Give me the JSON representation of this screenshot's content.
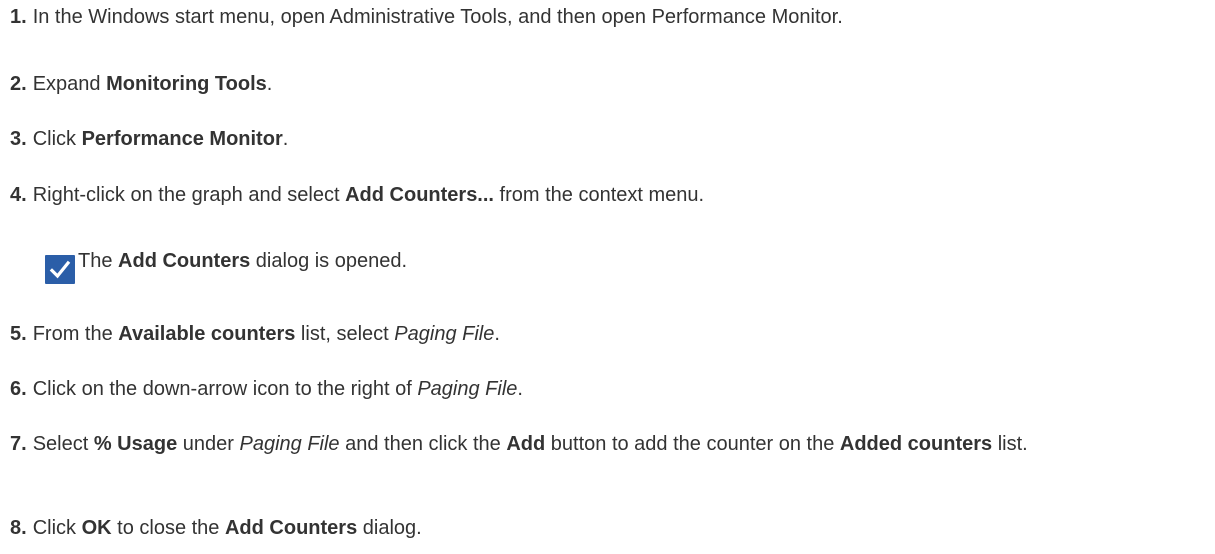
{
  "steps": [
    {
      "number": "1.",
      "parts": [
        {
          "t": "In the Windows start menu, open Administrative Tools, and then open Performance Monitor."
        }
      ]
    },
    {
      "number": "2.",
      "parts": [
        {
          "t": "Expand "
        },
        {
          "t": "Monitoring Tools",
          "s": "b"
        },
        {
          "t": "."
        }
      ]
    },
    {
      "number": "3.",
      "parts": [
        {
          "t": "Click "
        },
        {
          "t": "Performance Monitor",
          "s": "b"
        },
        {
          "t": "."
        }
      ]
    },
    {
      "number": "4.",
      "parts": [
        {
          "t": "Right-click on the graph and select "
        },
        {
          "t": "Add Counters...",
          "s": "b"
        },
        {
          "t": " from the context menu."
        }
      ]
    },
    {
      "number": "5.",
      "parts": [
        {
          "t": "From the "
        },
        {
          "t": "Available counters",
          "s": "b"
        },
        {
          "t": " list, select "
        },
        {
          "t": "Paging File",
          "s": "i"
        },
        {
          "t": "."
        }
      ]
    },
    {
      "number": "6.",
      "parts": [
        {
          "t": "Click on the down-arrow icon to the right of "
        },
        {
          "t": "Paging File",
          "s": "i"
        },
        {
          "t": "."
        }
      ]
    },
    {
      "number": "7.",
      "parts": [
        {
          "t": "Select "
        },
        {
          "t": "% Usage",
          "s": "b"
        },
        {
          "t": " under "
        },
        {
          "t": "Paging File",
          "s": "i"
        },
        {
          "t": " and then click the "
        },
        {
          "t": "Add",
          "s": "b"
        },
        {
          "t": " button to add the counter on the "
        },
        {
          "t": "Added counters",
          "s": "b"
        },
        {
          "t": " list."
        }
      ]
    },
    {
      "number": "8.",
      "parts": [
        {
          "t": "Click "
        },
        {
          "t": "OK",
          "s": "b"
        },
        {
          "t": " to close the "
        },
        {
          "t": "Add Counters",
          "s": "b"
        },
        {
          "t": " dialog."
        }
      ]
    }
  ],
  "result": {
    "icon": "checkmark-icon",
    "icon_color": "#2b5ea8",
    "parts": [
      {
        "t": "The "
      },
      {
        "t": "Add Counters",
        "s": "b"
      },
      {
        "t": " dialog is opened."
      }
    ]
  }
}
